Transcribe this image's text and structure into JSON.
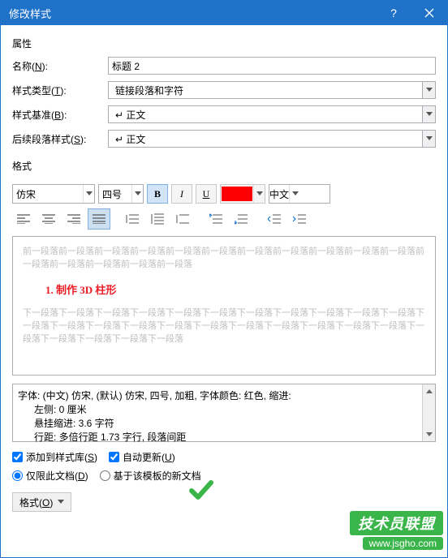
{
  "titlebar": {
    "title": "修改样式"
  },
  "sections": {
    "properties": "属性",
    "format": "格式"
  },
  "labels": {
    "name": "名称(",
    "name_u": "N",
    "name_end": "):",
    "styleType": "样式类型(",
    "styleType_u": "T",
    "styleType_end": "):",
    "basedOn": "样式基准(",
    "basedOn_u": "B",
    "basedOn_end": "):",
    "followStyle": "后续段落样式(",
    "followStyle_u": "S",
    "followStyle_end": "):"
  },
  "values": {
    "name": "标题 2",
    "styleType": "链接段落和字符",
    "basedOn": "↵ 正文",
    "followStyle": "↵ 正文",
    "font": "仿宋",
    "size": "四号",
    "lang": "中文",
    "color": "#ff0000"
  },
  "preview": {
    "before": "前一段落前一段落前一段落前一段落前一段落前一段落前一段落前一段落前一段落前一段落前一段落前一段落前一段落前一段落前一段落前一段落",
    "main": "1.  制作 3D 柱形",
    "after1": "下一段落下一段落下一段落下一段落下一段落下一段落下一段落下一段落下一段落下一段落下一段落下一段落下一段落下一段落下一段落下一段落下一段落下一段落下一段落下一段落下一段落下一段落下一段落下一段落下一段落下一段落下一段落"
  },
  "desc": {
    "l1": "字体: (中文) 仿宋, (默认) 仿宋, 四号, 加粗, 字体颜色: 红色, 缩进:",
    "l2": "左侧:  0 厘米",
    "l3": "悬挂缩进: 3.6 字符",
    "l4": "行距: 多倍行距 1.73 字行, 段落间距"
  },
  "checks": {
    "addToGallery": "添加到样式库(",
    "addToGallery_u": "S",
    "addToGallery_end": ")",
    "autoUpdate": "自动更新(",
    "autoUpdate_u": "U",
    "autoUpdate_end": ")",
    "thisDoc": "仅限此文档(",
    "thisDoc_u": "D",
    "thisDoc_end": ")",
    "template": "基于该模板的新文档"
  },
  "buttons": {
    "format": "格式(",
    "format_u": "O",
    "format_end": ")"
  },
  "wm": {
    "top": "技术员联盟",
    "bot": " www.jsgho.com "
  }
}
